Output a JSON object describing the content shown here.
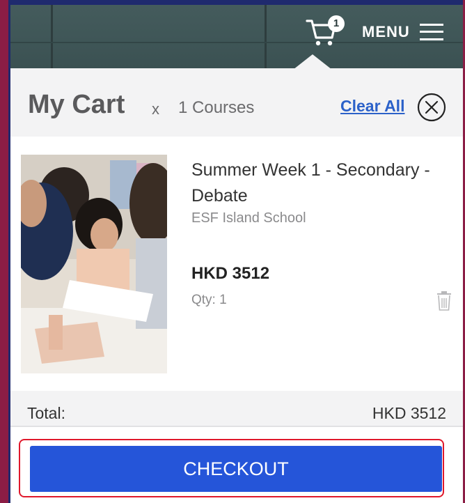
{
  "header": {
    "cart_badge_count": "1",
    "menu_label": "MENU"
  },
  "cart": {
    "title": "My Cart",
    "multiplier": "x",
    "count_label": "1 Courses",
    "clear_all_label": "Clear All",
    "items": [
      {
        "name": "Summer Week 1 - Secondary - Debate",
        "school": "ESF Island School",
        "price": "HKD 3512",
        "qty": "Qty: 1"
      }
    ],
    "total_label": "Total:",
    "total_value": "HKD 3512",
    "checkout_label": "CHECKOUT"
  },
  "colors": {
    "accent_blue": "#2555d9",
    "link_blue": "#2b61c9",
    "highlight_red": "#e0182b",
    "header_teal": "#455c5d",
    "frame_maroon": "#8b1d45",
    "frame_navy": "#1f2a6e"
  },
  "icons": {
    "cart": "cart-icon",
    "menu": "hamburger-icon",
    "close": "circle-x-icon",
    "delete": "trash-icon"
  }
}
